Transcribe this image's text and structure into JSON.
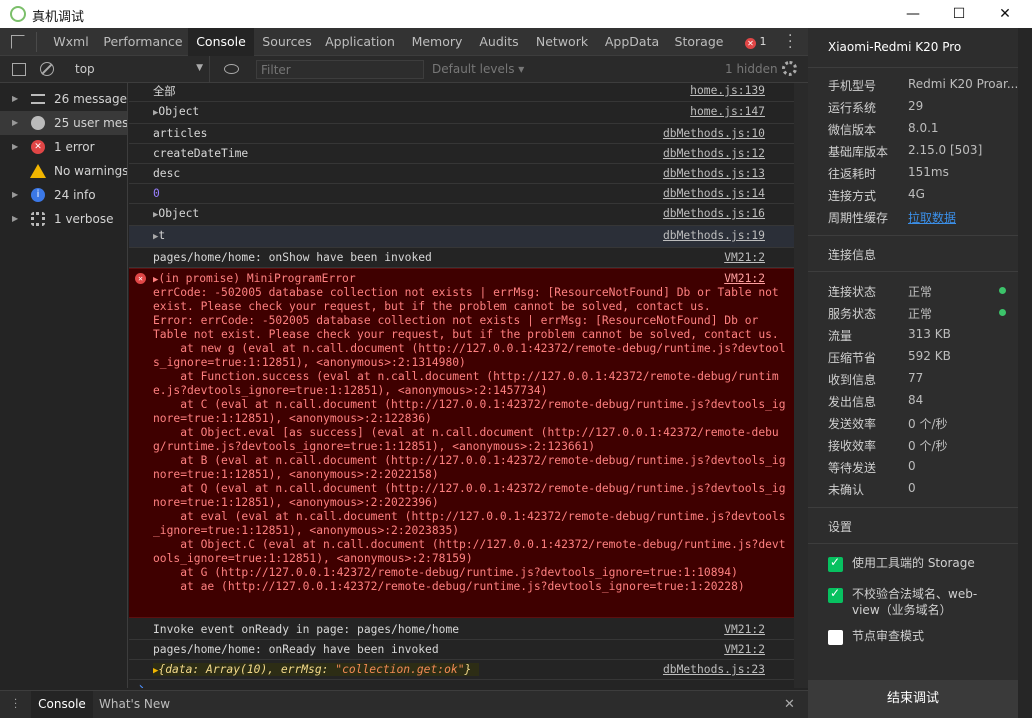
{
  "window": {
    "title": "真机调试",
    "min_glyph": "—",
    "max_glyph": "☐",
    "close_glyph": "✕"
  },
  "tabs": [
    {
      "label": "Wxml"
    },
    {
      "label": "Performance"
    },
    {
      "label": "Console"
    },
    {
      "label": "Sources"
    },
    {
      "label": "Application"
    },
    {
      "label": "Memory"
    },
    {
      "label": "Audits"
    },
    {
      "label": "Network"
    },
    {
      "label": "AppData"
    },
    {
      "label": "Storage"
    }
  ],
  "error_badge": {
    "count": "1"
  },
  "toolbar": {
    "context": "top",
    "filter_placeholder": "Filter",
    "levels": "Default levels ▾",
    "hidden": "1 hidden"
  },
  "sidebar": {
    "items": [
      {
        "label": "26 messages"
      },
      {
        "label": "25 user mes..."
      },
      {
        "label": "1 error"
      },
      {
        "label": "No warnings"
      },
      {
        "label": "24 info"
      },
      {
        "label": "1 verbose"
      }
    ]
  },
  "console": {
    "rows": [
      {
        "msg": "全部",
        "src": "home.js:139"
      },
      {
        "msg": "Object",
        "src": "home.js:147"
      },
      {
        "msg": "articles",
        "src": "dbMethods.js:10"
      },
      {
        "msg": "createDateTime",
        "src": "dbMethods.js:12"
      },
      {
        "msg": "desc",
        "src": "dbMethods.js:13"
      },
      {
        "msg": "0",
        "src": "dbMethods.js:14"
      },
      {
        "msg": "Object",
        "src": "dbMethods.js:16"
      },
      {
        "msg": "t",
        "src": "dbMethods.js:19"
      },
      {
        "msg": "pages/home/home: onShow have been invoked",
        "src": "VM21:2"
      }
    ],
    "error": {
      "head": "(in promise) MiniProgramError",
      "src": "VM21:2",
      "lines": [
        "errCode: -502005 database collection not exists | errMsg: [ResourceNotFound] Db or Table not",
        "exist. Please check your request, but if the problem cannot be solved, contact us.",
        "Error: errCode: -502005 database collection not exists | errMsg: [ResourceNotFound] Db or",
        "Table not exist. Please check your request, but if the problem cannot be solved, contact us.",
        "    at new g (eval at n.call.document (http://127.0.0.1:42372/remote-debug/runtime.js?devtool",
        "s_ignore=true:1:12851), <anonymous>:2:1314980)",
        "    at Function.success (eval at n.call.document (http://127.0.0.1:42372/remote-debug/runtim",
        "e.js?devtools_ignore=true:1:12851), <anonymous>:2:1457734)",
        "    at C (eval at n.call.document (http://127.0.0.1:42372/remote-debug/runtime.js?devtools_ig",
        "nore=true:1:12851), <anonymous>:2:122836)",
        "    at Object.eval [as success] (eval at n.call.document (http://127.0.0.1:42372/remote-debu",
        "g/runtime.js?devtools_ignore=true:1:12851), <anonymous>:2:123661)",
        "    at B (eval at n.call.document (http://127.0.0.1:42372/remote-debug/runtime.js?devtools_ig",
        "nore=true:1:12851), <anonymous>:2:2022158)",
        "    at Q (eval at n.call.document (http://127.0.0.1:42372/remote-debug/runtime.js?devtools_ig",
        "nore=true:1:12851), <anonymous>:2:2022396)",
        "    at eval (eval at n.call.document (http://127.0.0.1:42372/remote-debug/runtime.js?devtools",
        "_ignore=true:1:12851), <anonymous>:2:2023835)",
        "    at Object.C (eval at n.call.document (http://127.0.0.1:42372/remote-debug/runtime.js?devt",
        "ools_ignore=true:1:12851), <anonymous>:2:78159)",
        "    at G (http://127.0.0.1:42372/remote-debug/runtime.js?devtools_ignore=true:1:10894)",
        "    at ae (http://127.0.0.1:42372/remote-debug/runtime.js?devtools_ignore=true:1:20228)"
      ]
    },
    "after": [
      {
        "msg": "Invoke event onReady in page: pages/home/home",
        "src": "VM21:2"
      },
      {
        "msg": "pages/home/home: onReady have been invoked",
        "src": "VM21:2"
      }
    ],
    "result": {
      "prefix": "{data: ",
      "array": "Array(10)",
      "mid": ", errMsg: ",
      "str": "\"collection.get:ok\"",
      "suffix": "}",
      "src": "dbMethods.js:23"
    },
    "prompt": "›"
  },
  "drawer": {
    "tabs": [
      {
        "label": "Console"
      },
      {
        "label": "What's New"
      }
    ],
    "close_glyph": "✕"
  },
  "device_panel": {
    "device_name": "Xiaomi-Redmi K20 Pro",
    "info": [
      {
        "k": "手机型号",
        "v": "Redmi K20 Proar..."
      },
      {
        "k": "运行系统",
        "v": "29"
      },
      {
        "k": "微信版本",
        "v": "8.0.1"
      },
      {
        "k": "基础库版本",
        "v": "2.15.0 [503]"
      },
      {
        "k": "往返耗时",
        "v": "151ms"
      },
      {
        "k": "连接方式",
        "v": "4G"
      },
      {
        "k": "周期性缓存",
        "v": "拉取数据"
      }
    ],
    "conn_title": "连接信息",
    "conn": [
      {
        "k": "连接状态",
        "v": "正常"
      },
      {
        "k": "服务状态",
        "v": "正常"
      },
      {
        "k": "流量",
        "v": "313 KB"
      },
      {
        "k": "压缩节省",
        "v": "592 KB"
      },
      {
        "k": "收到信息",
        "v": "77"
      },
      {
        "k": "发出信息",
        "v": "84"
      },
      {
        "k": "发送效率",
        "v": "0 个/秒"
      },
      {
        "k": "接收效率",
        "v": "0 个/秒"
      },
      {
        "k": "等待发送",
        "v": "0"
      },
      {
        "k": "未确认",
        "v": "0"
      }
    ],
    "settings_title": "设置",
    "settings": [
      {
        "label": "使用工具端的 Storage",
        "checked": true
      },
      {
        "label": "不校验合法域名、web-view（业务域名）",
        "checked": true
      },
      {
        "label": "节点审查模式",
        "checked": false
      }
    ],
    "end_button": "结束调试"
  },
  "colors": {
    "accent_green": "#07c160",
    "error_bg": "#3f0000",
    "error_text": "#ff8080"
  }
}
